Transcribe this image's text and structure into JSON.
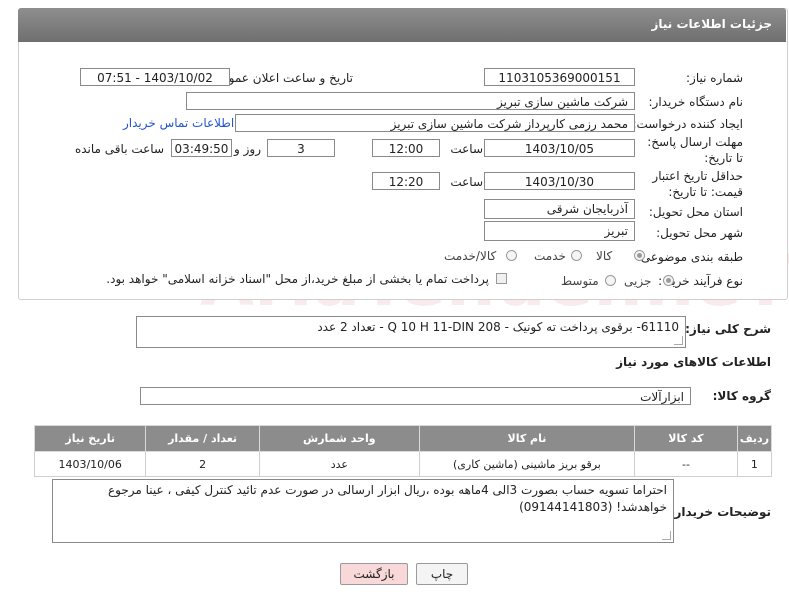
{
  "header": {
    "title": "جزئیات اطلاعات نیاز"
  },
  "form": {
    "need_number_label": "شماره نیاز:",
    "need_number": "1103105369000151",
    "announce_label": "تاریخ و ساعت اعلان عمومی:",
    "announce_value": "1403/10/02 - 07:51",
    "buyer_org_label": "نام دستگاه خریدار:",
    "buyer_org": "شرکت ماشین سازی تبریز",
    "creator_label": "ایجاد کننده درخواست:",
    "creator": "محمد رزمی کارپرداز شرکت ماشین سازی تبریز",
    "contact_link": "اطلاعات تماس خریدار",
    "reply_deadline_label": "مهلت ارسال پاسخ: تا تاریخ:",
    "reply_date": "1403/10/05",
    "time_label": "ساعت",
    "reply_time": "12:00",
    "days_value": "3",
    "days_label": "روز و",
    "remaining_time": "03:49:50",
    "remaining_label": "ساعت باقی مانده",
    "price_validity_label": "حداقل تاریخ اعتبار قیمت: تا تاریخ:",
    "price_date": "1403/10/30",
    "price_time": "12:20",
    "province_label": "استان محل تحویل:",
    "province": "آذربایجان شرقی",
    "city_label": "شهر محل تحویل:",
    "city": "تبریز",
    "category_label": "طبقه بندی موضوعی:",
    "category_options": [
      "کالا",
      "خدمت",
      "کالا/خدمت"
    ],
    "process_label": "نوع فرآیند خرید :",
    "process_options": [
      "جزیی",
      "متوسط"
    ],
    "payment_note": "پرداخت تمام یا بخشی از مبلغ خرید،از محل \"اسناد خزانه اسلامی\" خواهد بود."
  },
  "description": {
    "label": "شرح کلی نیاز:",
    "text": "61110- برقوی پرداخت ته کونیک - Q 10 H 11-DIN 208 - تعداد 2 عدد"
  },
  "goods": {
    "section_title": "اطلاعات کالاهای مورد نیاز",
    "group_label": "گروه کالا:",
    "group_value": "ابزارآلات",
    "columns": [
      "ردیف",
      "کد کالا",
      "نام کالا",
      "واحد شمارش",
      "تعداد / مقدار",
      "تاریخ نیاز"
    ],
    "rows": [
      {
        "row": "1",
        "code": "--",
        "name": "برقو بریز ماشینی (ماشین کاری)",
        "unit": "عدد",
        "qty": "2",
        "date": "1403/10/06"
      }
    ]
  },
  "buyer_notes": {
    "label": "توضیحات خریدار:",
    "text": "احتراما تسویه حساب بصورت 3الی 4ماهه بوده ،ریال ابزار ارسالی در صورت عدم تائید کنترل کیفی ، عینا مرجوع خواهدشد! (09144141803)"
  },
  "buttons": {
    "print": "چاپ",
    "back": "بازگشت"
  },
  "colors": {
    "header_bg": "#7d7d7d",
    "link": "#2255cc",
    "back_btn_bg": "#f8d8d8"
  }
}
